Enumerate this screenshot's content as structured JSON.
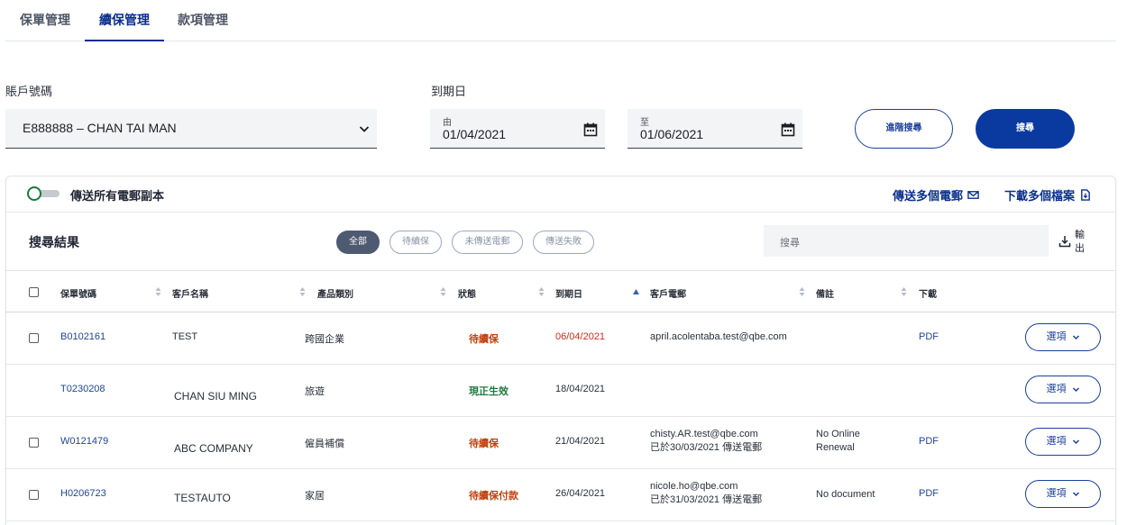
{
  "tabs": [
    "保單管理",
    "續保管理",
    "款項管理"
  ],
  "filters": {
    "account_label": "賬戶號碼",
    "account_value": "E888888 – CHAN TAI MAN",
    "expiry_label": "到期日",
    "from_label": "由",
    "from_value": "01/04/2021",
    "to_label": "至",
    "to_value": "01/06/2021",
    "advanced_search": "進階搜尋",
    "search": "搜尋"
  },
  "card": {
    "toggle_label": "傳送所有電郵副本",
    "send_multiple": "傳送多個電郵",
    "download_multiple": "下載多個檔案",
    "results_title": "搜尋結果",
    "chips": [
      "全部",
      "待續保",
      "未傳送電郵",
      "傳送失敗"
    ],
    "search_placeholder": "搜尋",
    "export_line1": "輸",
    "export_line2": "出"
  },
  "table": {
    "headers": [
      "保單號碼",
      "客戶名稱",
      "產品類別",
      "狀態",
      "到期日",
      "客戶電郵",
      "備註",
      "下載"
    ],
    "option_label": "選項",
    "rows": [
      {
        "policy": "B0102161",
        "name": "TEST",
        "product": "跨國企業",
        "status": "待續保",
        "expiry": "06/04/2021",
        "email": "april.acolentaba.test@qbe.com",
        "email_sub": "",
        "note1": "",
        "note2": "",
        "download": "PDF"
      },
      {
        "policy": "T0230208",
        "name": "CHAN SIU MING",
        "product": "旅遊",
        "status": "現正生效",
        "expiry": "18/04/2021",
        "email": "",
        "email_sub": "",
        "note1": "",
        "note2": "",
        "download": ""
      },
      {
        "policy": "W0121479",
        "name": "ABC COMPANY",
        "product": "僱員補償",
        "status": "待續保",
        "expiry": "21/04/2021",
        "email": "chisty.AR.test@qbe.com",
        "email_sub": "已於30/03/2021 傳送電郵",
        "note1": "No Online",
        "note2": "Renewal",
        "download": "PDF"
      },
      {
        "policy": "H0206723",
        "name": "TESTAUTO",
        "product": "家居",
        "status": "待續保付款",
        "expiry": "26/04/2021",
        "email": "nicole.ho@qbe.com",
        "email_sub": "已於31/03/2021 傳送電郵",
        "note1": "No document",
        "note2": "",
        "download": "PDF"
      }
    ]
  },
  "colors": {
    "primary": "#0a3aa0",
    "link": "#1d4596",
    "pending": "#c4410e",
    "active": "#217a3f",
    "overdue": "#d12b1f"
  }
}
